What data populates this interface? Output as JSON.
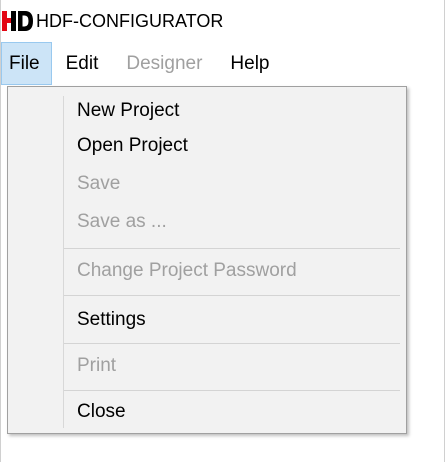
{
  "app": {
    "logo_text": "HD",
    "title": "HDF-CONFIGURATOR"
  },
  "menubar": {
    "items": [
      {
        "label": "File",
        "active": true,
        "enabled": true
      },
      {
        "label": "Edit",
        "active": false,
        "enabled": true
      },
      {
        "label": "Designer",
        "active": false,
        "enabled": false
      },
      {
        "label": "Help",
        "active": false,
        "enabled": true
      }
    ]
  },
  "file_menu": {
    "items": [
      {
        "label": "New Project",
        "enabled": true
      },
      {
        "label": "Open Project",
        "enabled": true
      },
      {
        "label": "Save",
        "enabled": false
      },
      {
        "label": "Save as ...",
        "enabled": false
      },
      {
        "label": "Change Project Password",
        "enabled": false
      },
      {
        "label": "Settings",
        "enabled": true
      },
      {
        "label": "Print",
        "enabled": false
      },
      {
        "label": "Close",
        "enabled": true
      }
    ]
  },
  "colors": {
    "logo_red": "#e30613",
    "logo_black": "#000000",
    "active_menu_bg": "#cce4f7",
    "active_menu_border": "#99c9ef",
    "disabled_text": "#a0a0a0",
    "dropdown_bg": "#f2f2f2"
  }
}
